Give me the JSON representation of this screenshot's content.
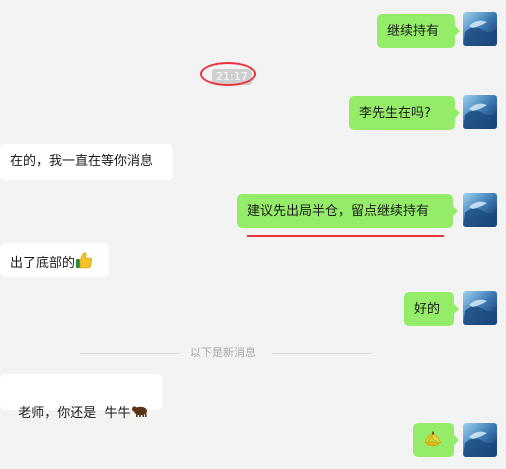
{
  "messages": {
    "m1": {
      "text": "继续持有"
    },
    "m2": {
      "text": "李先生在吗?"
    },
    "m3": {
      "text": "在的，我一直在等你消息"
    },
    "m4": {
      "text": "建议先出局半仓，留点继续持有"
    },
    "m5": {
      "text": "出了底部的"
    },
    "m6": {
      "text": "好的"
    },
    "m7": {
      "text": "老师，你还是  牛牛"
    },
    "m8": {
      "text": ""
    }
  },
  "timestamp": "21:17",
  "divider": {
    "label": "以下是新消息"
  },
  "icons": {
    "thumbs_up": "thumbs-up-emoji",
    "bull": "bull-emoji",
    "banana": "banana-emoji",
    "avatar": "avatar-ocean-photo"
  },
  "colors": {
    "outgoing_bubble": "#95ec69",
    "incoming_bubble": "#ffffff",
    "background": "#f3f3f3",
    "annotation": "#e8333a"
  }
}
